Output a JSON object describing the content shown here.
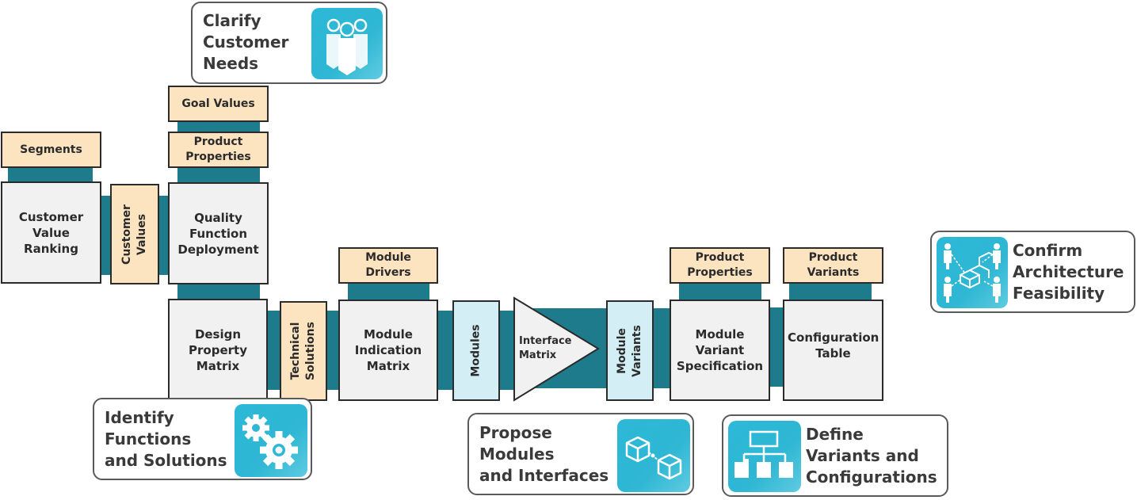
{
  "colors": {
    "connector": "#1e7b8c",
    "matrix_fill": "#f1f1f1",
    "artifact_fill": "#fde4c0",
    "module_fill": "#d3eff5",
    "phase_icon": "#2fb7d4"
  },
  "phases": {
    "clarify": {
      "label": "Clarify\nCustomer\nNeeds",
      "icon": "people-group-icon"
    },
    "identify": {
      "label": "Identify\nFunctions\nand Solutions",
      "icon": "gears-icon"
    },
    "propose": {
      "label": "Propose\nModules\nand Interfaces",
      "icon": "linked-cubes-icon"
    },
    "define": {
      "label": "Define\nVariants and\nConfigurations",
      "icon": "hierarchy-icon"
    },
    "confirm": {
      "label": "Confirm\nArchitecture\nFeasibility",
      "icon": "stakeholders-modules-icon"
    }
  },
  "matrices": {
    "cvr": "Customer Value Ranking",
    "qfd": "Quality Function Deployment",
    "dpm": "Design Property Matrix",
    "mim": "Module Indication Matrix",
    "interface": "Interface Matrix",
    "mvs": "Module Variant Specification",
    "config": "Configuration Table"
  },
  "inputs": {
    "segments": "Segments",
    "goal_values": "Goal Values",
    "product_properties_1": "Product Properties",
    "module_drivers": "Module Drivers",
    "product_properties_2": "Product Properties",
    "product_variants": "Product Variants"
  },
  "links": {
    "customer_values": "Customer\nValues",
    "technical_solutions": "Technical\nSolutions",
    "modules": "Modules",
    "module_variants": "Module\nVariants"
  }
}
